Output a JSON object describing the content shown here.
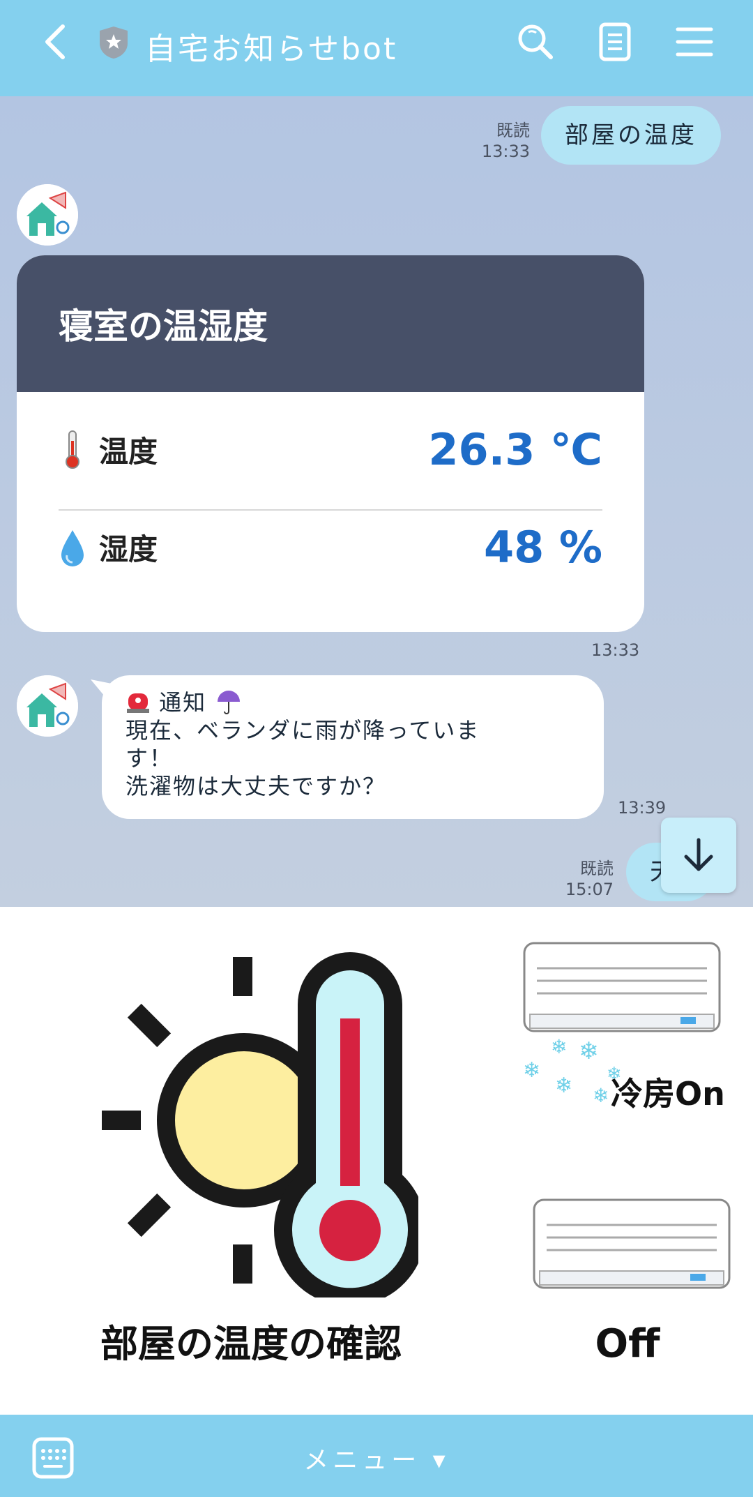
{
  "header": {
    "title": "自宅お知らせbot"
  },
  "messages": {
    "user1": {
      "read": "既読",
      "time": "13:33",
      "text": "部屋の温度"
    },
    "card": {
      "title": "寝室の温湿度",
      "temp_label": "温度",
      "temp_value": "26.3 ℃",
      "hum_label": "湿度",
      "hum_value": "48 %",
      "time": "13:33"
    },
    "bot_notice": {
      "line1": "通知",
      "line2": "現在、ベランダに雨が降っていま",
      "line3": "す！",
      "line4": "洗濯物は大丈夫ですか？",
      "time": "13:39"
    },
    "user2": {
      "read": "既読",
      "time": "15:07",
      "text": "天"
    }
  },
  "richmenu": {
    "left_label": "部屋の温度の確認",
    "right_top_label": "冷房On",
    "right_bottom_label": "Off"
  },
  "bottombar": {
    "menu_label": "メニュー ▾"
  }
}
